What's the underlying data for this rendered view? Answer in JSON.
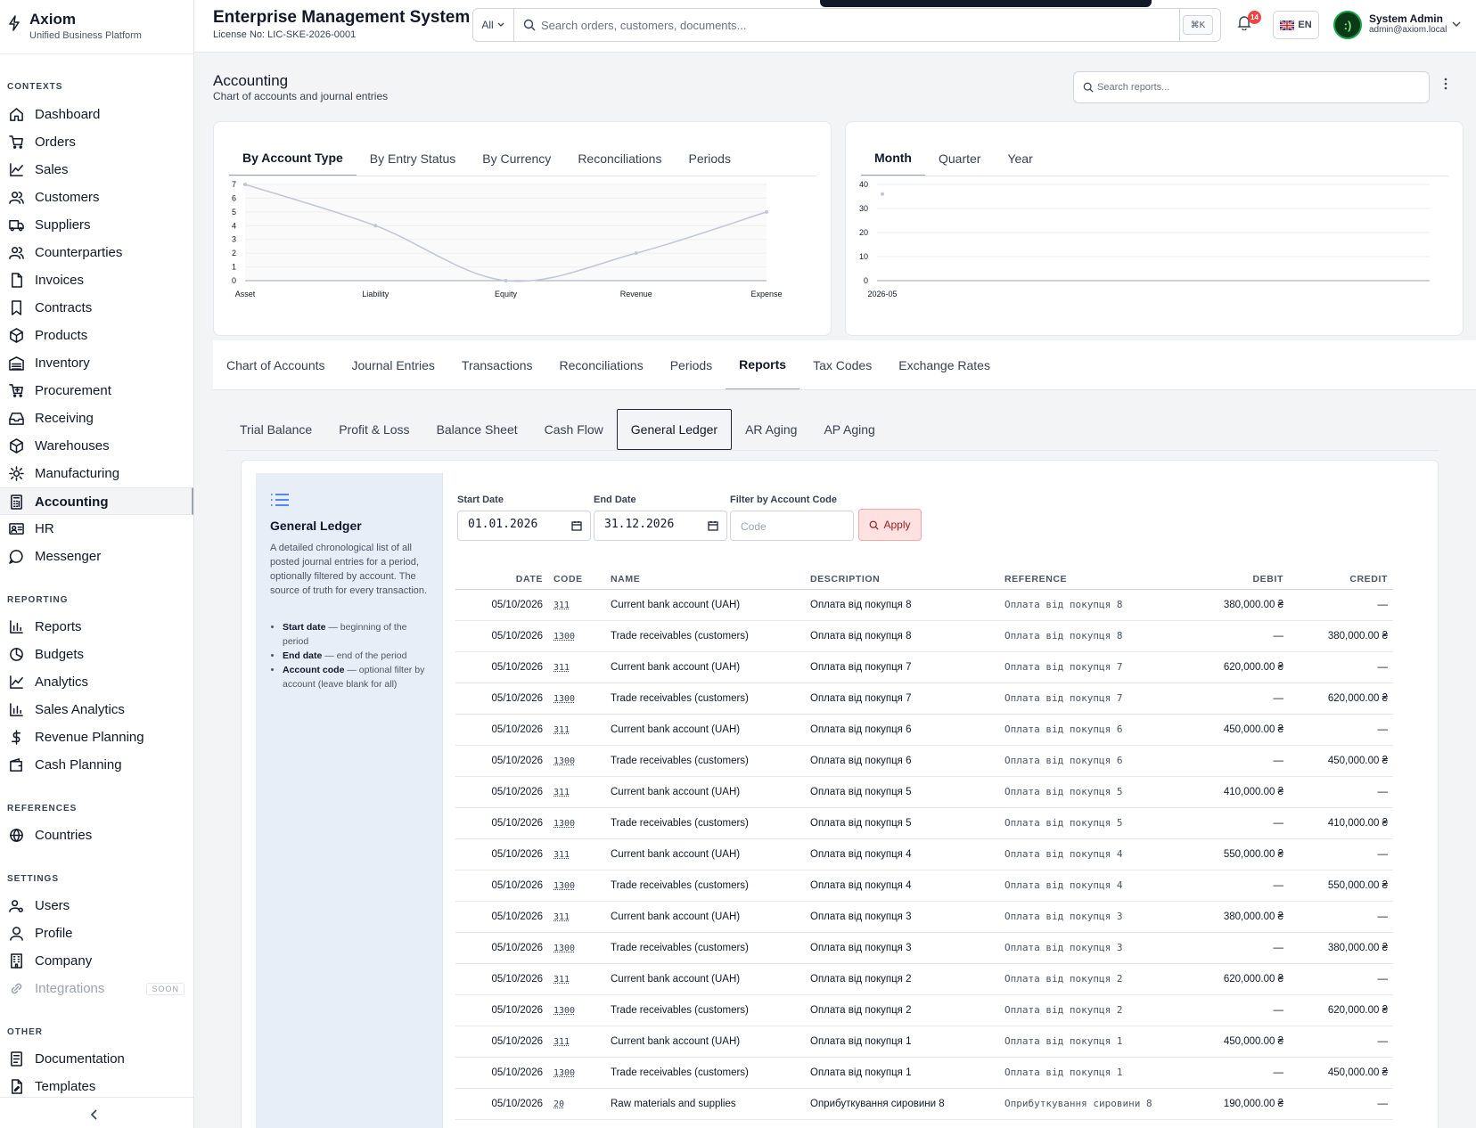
{
  "brand": {
    "name": "Axiom",
    "tagline": "Unified Business Platform"
  },
  "header": {
    "title": "Enterprise Management System",
    "license": "License No: LIC-SKE-2026-0001",
    "search_scope": "All",
    "search_placeholder": "Search orders, customers, documents...",
    "shortcut": "⌘K",
    "notifications": "14",
    "language": "EN",
    "user_name": "System Admin",
    "user_email": "admin@axiom.local"
  },
  "sidebar": {
    "sections": {
      "contexts": "CONTEXTS",
      "reporting": "REPORTING",
      "references": "REFERENCES",
      "settings": "SETTINGS",
      "other": "OTHER"
    },
    "contexts": [
      "Dashboard",
      "Orders",
      "Sales",
      "Customers",
      "Suppliers",
      "Counterparties",
      "Invoices",
      "Contracts",
      "Products",
      "Inventory",
      "Procurement",
      "Receiving",
      "Warehouses",
      "Manufacturing",
      "Accounting",
      "HR",
      "Messenger"
    ],
    "reporting": [
      "Reports",
      "Budgets",
      "Analytics",
      "Sales Analytics",
      "Revenue Planning",
      "Cash Planning"
    ],
    "references": [
      "Countries"
    ],
    "settings": [
      "Users",
      "Profile",
      "Company",
      "Integrations"
    ],
    "soon": "SOON",
    "other": [
      "Documentation",
      "Templates"
    ]
  },
  "page": {
    "title": "Accounting",
    "subtitle": "Chart of accounts and journal entries",
    "report_search_placeholder": "Search reports..."
  },
  "chart_tabs_left": [
    "By Account Type",
    "By Entry Status",
    "By Currency",
    "Reconciliations",
    "Periods"
  ],
  "chart_tabs_right": [
    "Month",
    "Quarter",
    "Year"
  ],
  "chart_data": [
    {
      "type": "line",
      "categories": [
        "Asset",
        "Liability",
        "Equity",
        "Revenue",
        "Expense"
      ],
      "values": [
        7,
        4,
        0,
        2,
        5
      ],
      "ylim": [
        0,
        7
      ],
      "yticks": [
        "0",
        "1",
        "2",
        "3",
        "4",
        "5",
        "6",
        "7"
      ],
      "grid": true
    },
    {
      "type": "scatter",
      "categories": [
        "2026-05"
      ],
      "values": [
        36
      ],
      "ylim": [
        0,
        40
      ],
      "yticks": [
        "0",
        "10",
        "20",
        "30",
        "40"
      ],
      "grid": true
    }
  ],
  "main_tabs": [
    "Chart of Accounts",
    "Journal Entries",
    "Transactions",
    "Reconciliations",
    "Periods",
    "Reports",
    "Tax Codes",
    "Exchange Rates"
  ],
  "report_tabs": [
    "Trial Balance",
    "Profit & Loss",
    "Balance Sheet",
    "Cash Flow",
    "General Ledger",
    "AR Aging",
    "AP Aging"
  ],
  "ledger": {
    "title": "General Ledger",
    "description": "A detailed chronological list of all posted journal entries for a period, optionally filtered by account. The source of truth for every transaction.",
    "bullets": [
      {
        "term": "Start date",
        "text": " — beginning of the period"
      },
      {
        "term": "End date",
        "text": " — end of the period"
      },
      {
        "term": "Account code",
        "text": " — optional filter by account (leave blank for all)"
      }
    ],
    "start_label": "Start Date",
    "start_value": "01.01.2026",
    "end_label": "End Date",
    "end_value": "31.12.2026",
    "code_label": "Filter by Account Code",
    "code_placeholder": "Code",
    "apply": "Apply",
    "columns": [
      "DATE",
      "CODE",
      "NAME",
      "DESCRIPTION",
      "REFERENCE",
      "DEBIT",
      "CREDIT"
    ],
    "rows": [
      [
        "05/10/2026",
        "311",
        "Current bank account (UAH)",
        "Оплата від покупця 8",
        "Оплата від покупця 8",
        "380,000.00 ₴",
        "—"
      ],
      [
        "05/10/2026",
        "1300",
        "Trade receivables (customers)",
        "Оплата від покупця 8",
        "Оплата від покупця 8",
        "—",
        "380,000.00 ₴"
      ],
      [
        "05/10/2026",
        "311",
        "Current bank account (UAH)",
        "Оплата від покупця 7",
        "Оплата від покупця 7",
        "620,000.00 ₴",
        "—"
      ],
      [
        "05/10/2026",
        "1300",
        "Trade receivables (customers)",
        "Оплата від покупця 7",
        "Оплата від покупця 7",
        "—",
        "620,000.00 ₴"
      ],
      [
        "05/10/2026",
        "311",
        "Current bank account (UAH)",
        "Оплата від покупця 6",
        "Оплата від покупця 6",
        "450,000.00 ₴",
        "—"
      ],
      [
        "05/10/2026",
        "1300",
        "Trade receivables (customers)",
        "Оплата від покупця 6",
        "Оплата від покупця 6",
        "—",
        "450,000.00 ₴"
      ],
      [
        "05/10/2026",
        "311",
        "Current bank account (UAH)",
        "Оплата від покупця 5",
        "Оплата від покупця 5",
        "410,000.00 ₴",
        "—"
      ],
      [
        "05/10/2026",
        "1300",
        "Trade receivables (customers)",
        "Оплата від покупця 5",
        "Оплата від покупця 5",
        "—",
        "410,000.00 ₴"
      ],
      [
        "05/10/2026",
        "311",
        "Current bank account (UAH)",
        "Оплата від покупця 4",
        "Оплата від покупця 4",
        "550,000.00 ₴",
        "—"
      ],
      [
        "05/10/2026",
        "1300",
        "Trade receivables (customers)",
        "Оплата від покупця 4",
        "Оплата від покупця 4",
        "—",
        "550,000.00 ₴"
      ],
      [
        "05/10/2026",
        "311",
        "Current bank account (UAH)",
        "Оплата від покупця 3",
        "Оплата від покупця 3",
        "380,000.00 ₴",
        "—"
      ],
      [
        "05/10/2026",
        "1300",
        "Trade receivables (customers)",
        "Оплата від покупця 3",
        "Оплата від покупця 3",
        "—",
        "380,000.00 ₴"
      ],
      [
        "05/10/2026",
        "311",
        "Current bank account (UAH)",
        "Оплата від покупця 2",
        "Оплата від покупця 2",
        "620,000.00 ₴",
        "—"
      ],
      [
        "05/10/2026",
        "1300",
        "Trade receivables (customers)",
        "Оплата від покупця 2",
        "Оплата від покупця 2",
        "—",
        "620,000.00 ₴"
      ],
      [
        "05/10/2026",
        "311",
        "Current bank account (UAH)",
        "Оплата від покупця 1",
        "Оплата від покупця 1",
        "450,000.00 ₴",
        "—"
      ],
      [
        "05/10/2026",
        "1300",
        "Trade receivables (customers)",
        "Оплата від покупця 1",
        "Оплата від покупця 1",
        "—",
        "450,000.00 ₴"
      ],
      [
        "05/10/2026",
        "20",
        "Raw materials and supplies",
        "Оприбуткування сировини 8",
        "Оприбуткування сировини 8",
        "190,000.00 ₴",
        "—"
      ]
    ]
  }
}
